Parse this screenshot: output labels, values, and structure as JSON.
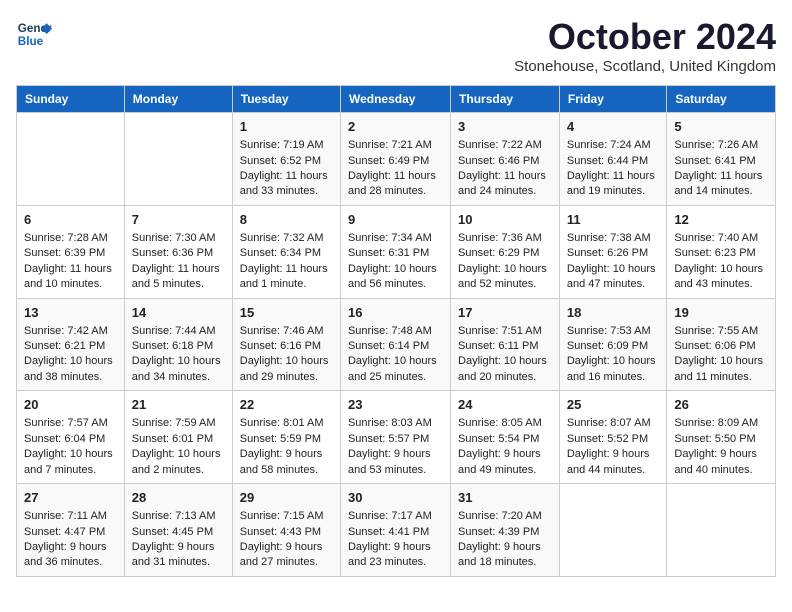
{
  "header": {
    "logo_line1": "General",
    "logo_line2": "Blue",
    "month": "October 2024",
    "location": "Stonehouse, Scotland, United Kingdom"
  },
  "days_of_week": [
    "Sunday",
    "Monday",
    "Tuesday",
    "Wednesday",
    "Thursday",
    "Friday",
    "Saturday"
  ],
  "weeks": [
    [
      {
        "day": "",
        "info": ""
      },
      {
        "day": "",
        "info": ""
      },
      {
        "day": "1",
        "info": "Sunrise: 7:19 AM\nSunset: 6:52 PM\nDaylight: 11 hours\nand 33 minutes."
      },
      {
        "day": "2",
        "info": "Sunrise: 7:21 AM\nSunset: 6:49 PM\nDaylight: 11 hours\nand 28 minutes."
      },
      {
        "day": "3",
        "info": "Sunrise: 7:22 AM\nSunset: 6:46 PM\nDaylight: 11 hours\nand 24 minutes."
      },
      {
        "day": "4",
        "info": "Sunrise: 7:24 AM\nSunset: 6:44 PM\nDaylight: 11 hours\nand 19 minutes."
      },
      {
        "day": "5",
        "info": "Sunrise: 7:26 AM\nSunset: 6:41 PM\nDaylight: 11 hours\nand 14 minutes."
      }
    ],
    [
      {
        "day": "6",
        "info": "Sunrise: 7:28 AM\nSunset: 6:39 PM\nDaylight: 11 hours\nand 10 minutes."
      },
      {
        "day": "7",
        "info": "Sunrise: 7:30 AM\nSunset: 6:36 PM\nDaylight: 11 hours\nand 5 minutes."
      },
      {
        "day": "8",
        "info": "Sunrise: 7:32 AM\nSunset: 6:34 PM\nDaylight: 11 hours\nand 1 minute."
      },
      {
        "day": "9",
        "info": "Sunrise: 7:34 AM\nSunset: 6:31 PM\nDaylight: 10 hours\nand 56 minutes."
      },
      {
        "day": "10",
        "info": "Sunrise: 7:36 AM\nSunset: 6:29 PM\nDaylight: 10 hours\nand 52 minutes."
      },
      {
        "day": "11",
        "info": "Sunrise: 7:38 AM\nSunset: 6:26 PM\nDaylight: 10 hours\nand 47 minutes."
      },
      {
        "day": "12",
        "info": "Sunrise: 7:40 AM\nSunset: 6:23 PM\nDaylight: 10 hours\nand 43 minutes."
      }
    ],
    [
      {
        "day": "13",
        "info": "Sunrise: 7:42 AM\nSunset: 6:21 PM\nDaylight: 10 hours\nand 38 minutes."
      },
      {
        "day": "14",
        "info": "Sunrise: 7:44 AM\nSunset: 6:18 PM\nDaylight: 10 hours\nand 34 minutes."
      },
      {
        "day": "15",
        "info": "Sunrise: 7:46 AM\nSunset: 6:16 PM\nDaylight: 10 hours\nand 29 minutes."
      },
      {
        "day": "16",
        "info": "Sunrise: 7:48 AM\nSunset: 6:14 PM\nDaylight: 10 hours\nand 25 minutes."
      },
      {
        "day": "17",
        "info": "Sunrise: 7:51 AM\nSunset: 6:11 PM\nDaylight: 10 hours\nand 20 minutes."
      },
      {
        "day": "18",
        "info": "Sunrise: 7:53 AM\nSunset: 6:09 PM\nDaylight: 10 hours\nand 16 minutes."
      },
      {
        "day": "19",
        "info": "Sunrise: 7:55 AM\nSunset: 6:06 PM\nDaylight: 10 hours\nand 11 minutes."
      }
    ],
    [
      {
        "day": "20",
        "info": "Sunrise: 7:57 AM\nSunset: 6:04 PM\nDaylight: 10 hours\nand 7 minutes."
      },
      {
        "day": "21",
        "info": "Sunrise: 7:59 AM\nSunset: 6:01 PM\nDaylight: 10 hours\nand 2 minutes."
      },
      {
        "day": "22",
        "info": "Sunrise: 8:01 AM\nSunset: 5:59 PM\nDaylight: 9 hours\nand 58 minutes."
      },
      {
        "day": "23",
        "info": "Sunrise: 8:03 AM\nSunset: 5:57 PM\nDaylight: 9 hours\nand 53 minutes."
      },
      {
        "day": "24",
        "info": "Sunrise: 8:05 AM\nSunset: 5:54 PM\nDaylight: 9 hours\nand 49 minutes."
      },
      {
        "day": "25",
        "info": "Sunrise: 8:07 AM\nSunset: 5:52 PM\nDaylight: 9 hours\nand 44 minutes."
      },
      {
        "day": "26",
        "info": "Sunrise: 8:09 AM\nSunset: 5:50 PM\nDaylight: 9 hours\nand 40 minutes."
      }
    ],
    [
      {
        "day": "27",
        "info": "Sunrise: 7:11 AM\nSunset: 4:47 PM\nDaylight: 9 hours\nand 36 minutes."
      },
      {
        "day": "28",
        "info": "Sunrise: 7:13 AM\nSunset: 4:45 PM\nDaylight: 9 hours\nand 31 minutes."
      },
      {
        "day": "29",
        "info": "Sunrise: 7:15 AM\nSunset: 4:43 PM\nDaylight: 9 hours\nand 27 minutes."
      },
      {
        "day": "30",
        "info": "Sunrise: 7:17 AM\nSunset: 4:41 PM\nDaylight: 9 hours\nand 23 minutes."
      },
      {
        "day": "31",
        "info": "Sunrise: 7:20 AM\nSunset: 4:39 PM\nDaylight: 9 hours\nand 18 minutes."
      },
      {
        "day": "",
        "info": ""
      },
      {
        "day": "",
        "info": ""
      }
    ]
  ]
}
